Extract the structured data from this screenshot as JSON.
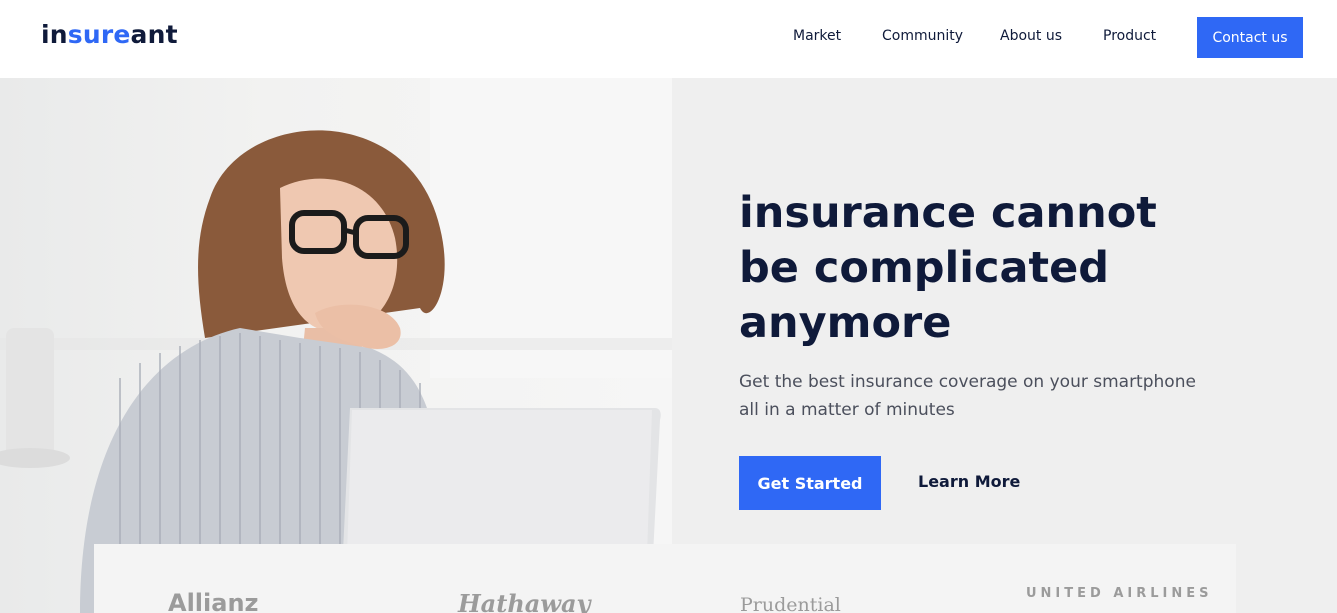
{
  "header": {
    "logo": {
      "part1": "in",
      "part2": "sure",
      "part3": "ant"
    },
    "nav": [
      {
        "label": "Market"
      },
      {
        "label": "Community"
      },
      {
        "label": "About us"
      },
      {
        "label": "Product"
      }
    ],
    "contact_label": "Contact us"
  },
  "hero": {
    "headline_line1": "insurance cannot",
    "headline_line2": "be complicated",
    "headline_line3": "anymore",
    "subtext_line1": "Get the best insurance coverage on your smartphone",
    "subtext_line2": "all in a matter of minutes",
    "primary_cta": "Get Started",
    "secondary_cta": "Learn More"
  },
  "partners": [
    {
      "name": "Allianz"
    },
    {
      "name": "Hathaway"
    },
    {
      "name": "Prudential"
    },
    {
      "name": "UNITED AIRLINES"
    }
  ],
  "colors": {
    "accent": "#2f68f5",
    "text_dark": "#0f1a3a",
    "hero_bg": "#efefef"
  }
}
